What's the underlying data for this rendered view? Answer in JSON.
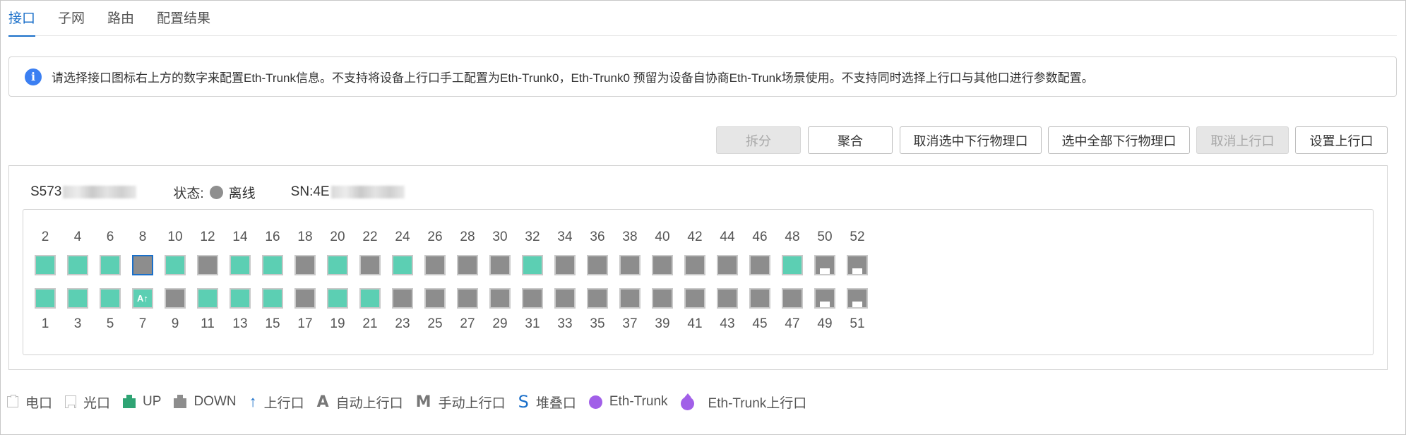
{
  "tabs": [
    {
      "label": "接口",
      "active": true
    },
    {
      "label": "子网",
      "active": false
    },
    {
      "label": "路由",
      "active": false
    },
    {
      "label": "配置结果",
      "active": false
    }
  ],
  "info": {
    "icon": "info-icon",
    "text": "请选择接口图标右上方的数字来配置Eth-Trunk信息。不支持将设备上行口手工配置为Eth-Trunk0，Eth-Trunk0 预留为设备自协商Eth-Trunk场景使用。不支持同时选择上行口与其他口进行参数配置。"
  },
  "actions": {
    "split": "拆分",
    "aggregate": "聚合",
    "deselect_downlink": "取消选中下行物理口",
    "select_all_downlink": "选中全部下行物理口",
    "cancel_uplink": "取消上行口",
    "set_uplink": "设置上行口"
  },
  "device": {
    "model_prefix": "S573",
    "status_label": "状态:",
    "status_value": "离线",
    "sn_prefix": "SN:4E"
  },
  "ports": {
    "top_row": [
      {
        "num": "2",
        "state": "up"
      },
      {
        "num": "4",
        "state": "up"
      },
      {
        "num": "6",
        "state": "up"
      },
      {
        "num": "8",
        "state": "selected"
      },
      {
        "num": "10",
        "state": "up"
      },
      {
        "num": "12",
        "state": "down"
      },
      {
        "num": "14",
        "state": "up"
      },
      {
        "num": "16",
        "state": "up"
      },
      {
        "num": "18",
        "state": "down"
      },
      {
        "num": "20",
        "state": "up"
      },
      {
        "num": "22",
        "state": "down"
      },
      {
        "num": "24",
        "state": "up"
      },
      {
        "num": "26",
        "state": "down"
      },
      {
        "num": "28",
        "state": "down"
      },
      {
        "num": "30",
        "state": "down"
      },
      {
        "num": "32",
        "state": "up"
      },
      {
        "num": "34",
        "state": "down"
      },
      {
        "num": "36",
        "state": "down"
      },
      {
        "num": "38",
        "state": "down"
      },
      {
        "num": "40",
        "state": "down"
      },
      {
        "num": "42",
        "state": "down"
      },
      {
        "num": "44",
        "state": "down"
      },
      {
        "num": "46",
        "state": "down"
      },
      {
        "num": "48",
        "state": "up"
      },
      {
        "num": "50",
        "state": "optical"
      },
      {
        "num": "52",
        "state": "optical"
      }
    ],
    "bottom_row": [
      {
        "num": "1",
        "state": "up"
      },
      {
        "num": "3",
        "state": "up"
      },
      {
        "num": "5",
        "state": "up"
      },
      {
        "num": "7",
        "state": "up-uplink",
        "mark": "A↑"
      },
      {
        "num": "9",
        "state": "down"
      },
      {
        "num": "11",
        "state": "up"
      },
      {
        "num": "13",
        "state": "up"
      },
      {
        "num": "15",
        "state": "up"
      },
      {
        "num": "17",
        "state": "down"
      },
      {
        "num": "19",
        "state": "up"
      },
      {
        "num": "21",
        "state": "up"
      },
      {
        "num": "23",
        "state": "down"
      },
      {
        "num": "25",
        "state": "down"
      },
      {
        "num": "27",
        "state": "down"
      },
      {
        "num": "29",
        "state": "down"
      },
      {
        "num": "31",
        "state": "down"
      },
      {
        "num": "33",
        "state": "down"
      },
      {
        "num": "35",
        "state": "down"
      },
      {
        "num": "37",
        "state": "down"
      },
      {
        "num": "39",
        "state": "down"
      },
      {
        "num": "41",
        "state": "down"
      },
      {
        "num": "43",
        "state": "down"
      },
      {
        "num": "45",
        "state": "down"
      },
      {
        "num": "47",
        "state": "down"
      },
      {
        "num": "49",
        "state": "optical"
      },
      {
        "num": "51",
        "state": "optical"
      }
    ]
  },
  "legend": {
    "electrical": "电口",
    "optical": "光口",
    "up": "UP",
    "down": "DOWN",
    "uplink": "上行口",
    "auto_uplink_letter": "A",
    "auto_uplink": "自动上行口",
    "manual_uplink_letter": "M",
    "manual_uplink": "手动上行口",
    "stack_letter": "S",
    "stack": "堆叠口",
    "eth_trunk": "Eth-Trunk",
    "eth_trunk_uplink": "Eth-Trunk上行口",
    "colors": {
      "up": "#5ccfb3",
      "down": "#8d8d8d",
      "selected_border": "#1a6fc9",
      "uplink_arrow": "#1a6fc9",
      "eth_trunk": "#a15fe8"
    }
  }
}
